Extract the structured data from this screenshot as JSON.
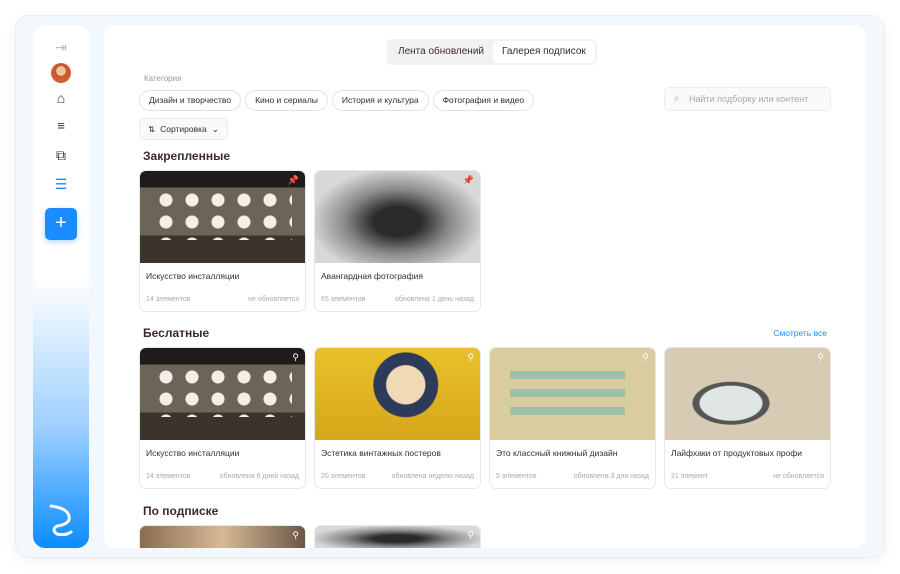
{
  "sidebar": {
    "icons": [
      "collapse-icon",
      "avatar",
      "home-icon",
      "filter-icon",
      "add-collection-icon",
      "collections-icon",
      "add-icon",
      "logo"
    ],
    "add_label": "+"
  },
  "tabs": [
    {
      "label": "Лента обновлений",
      "active": false
    },
    {
      "label": "Галерея подписок",
      "active": true
    }
  ],
  "category_label": "Категория",
  "categories": [
    "Дизайн и творчество",
    "Кино и сериалы",
    "История и культура",
    "Фотография и видео"
  ],
  "search": {
    "placeholder": "Найти подборку или контент"
  },
  "sort_label": "Сортировка",
  "sections": {
    "pinned": {
      "title": "Закрепленные",
      "cards": [
        {
          "title": "Искусство инсталляции",
          "count": "14 элементов",
          "updated": "не обновляется"
        },
        {
          "title": "Авангардная фотография",
          "count": "65 элементов",
          "updated": "обновлена 1 день назад"
        }
      ]
    },
    "free": {
      "title": "Беслатные",
      "see_all": "Смотреть все",
      "cards": [
        {
          "title": "Искусство инсталляции",
          "count": "14 элементов",
          "updated": "обновлена 6 дней назад"
        },
        {
          "title": "Эстетика винтажных постеров",
          "count": "20 элементов",
          "updated": "обновлена неделю назад"
        },
        {
          "title": "Это классный книжный дизайн",
          "count": "5 элементов",
          "updated": "обновлена 3 дня назад"
        },
        {
          "title": "Лайфхаки от продуктовых профи",
          "count": "21 элемент",
          "updated": "не обновляется"
        }
      ]
    },
    "subscription": {
      "title": "По подписке"
    }
  },
  "colors": {
    "accent": "#1a8cff",
    "text": "#3b2b29"
  }
}
